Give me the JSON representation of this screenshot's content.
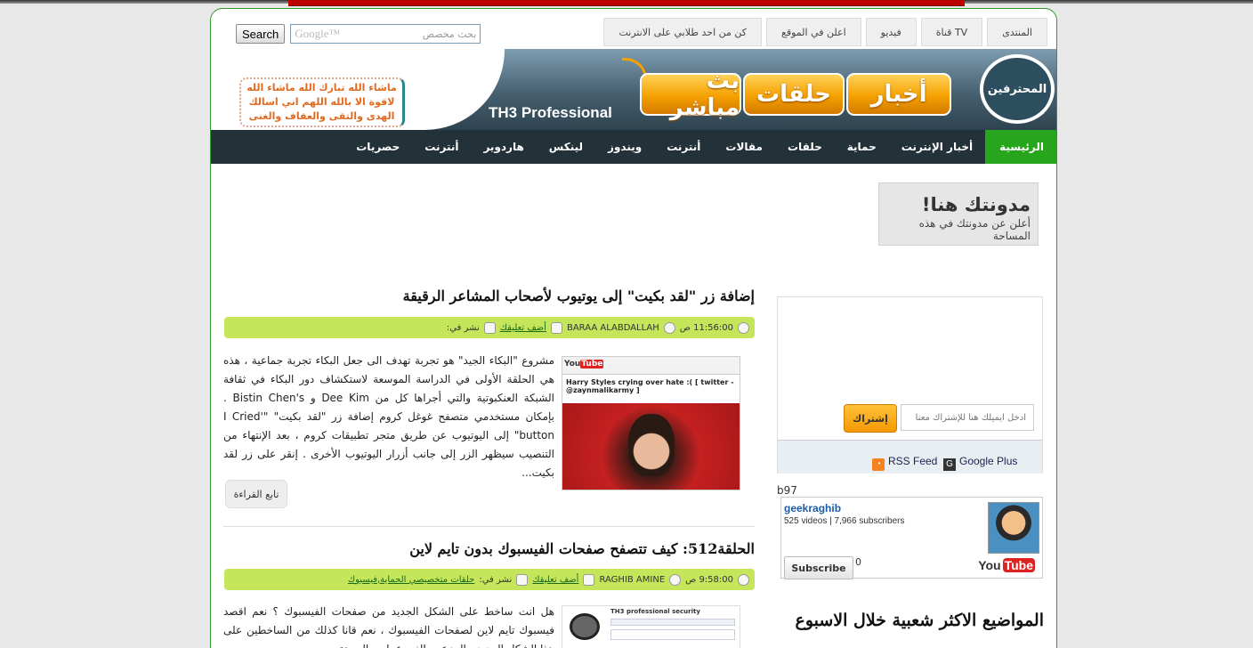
{
  "top_links": [
    "المنتدى",
    "قناة TV",
    "فيديو",
    "اعلن في الموقع",
    "كن من احد طلابي على الانترنت"
  ],
  "search": {
    "button": "Search",
    "google_label": "Google™",
    "placeholder": "بحث مخصص"
  },
  "banner": {
    "slogan": "ماشاء الله تبارك الله ماشاء الله لاقوة الا بالله اللهم اني اسالك الهدى والتقى والعفاف والغنى",
    "brand_en": "TH3 Professional",
    "buttons": [
      "أخبار",
      "حلقات",
      "بث مباشر"
    ],
    "logo_text": "المحترفين"
  },
  "nav": [
    "الرئيسية",
    "أخبار الإنترنت",
    "حماية",
    "حلقات",
    "مقالات",
    "أنترنت",
    "ويندوز",
    "لينكس",
    "هاردوير",
    "أنترنت",
    "حصريات"
  ],
  "sidebar": {
    "ad_title": "مدونتك هنا!",
    "ad_sub": "أعلن عن مدونتك في هذه المساحة",
    "subscribe_placeholder": "ادخل ايميلك هنا للإشتراك معنا",
    "subscribe_button": "إشتراك",
    "google_plus": "Google Plus",
    "rss": "RSS Feed",
    "b97": "b97",
    "yt_channel": "geekraghib",
    "yt_stats": "525 videos | 7,966 subscribers",
    "yt_subscribe": "Subscribe",
    "yt_count": "0",
    "yt_logo_you": "You",
    "yt_logo_tube": "Tube",
    "popular_title": "المواضيع الاكثر شعبية خلال الاسبوع"
  },
  "posts": [
    {
      "title": "إضافة زر \"لقد بكيت\" إلى يوتيوب لأصحاب المشاعر الرقيقة",
      "time": "11:56:00 ص",
      "author": "BARAA ALABDALLAH",
      "comment": "أضف تعليقك",
      "posted_in": "نشر في:",
      "category": "",
      "excerpt": "مشروع \"البكاء الجيد\" هو تجربة تهدف الى جعل البكاء تجربة جماعية ، هذه هي الحلقة الأولى في الدراسة الموسعة لاستكشاف دور البكاء في ثقافة الشبكة العنكبوتية والتي أجراها كل من Dee Kim و Bistin Chen's . بإمكان مستخدمي متصفح غوغل كروم إضافة زر \"لقد بكيت\" \"I Cried' button\" إلى اليوتيوب عن طريق متجر تطبيقات كروم ، بعد الإنتهاء من التنصيب سيظهر الزر إلى جانب أزرار اليوتيوب الأخرى . إنقر على زر لقد بكيت...",
      "read_more": "تابع القراءة",
      "thumb_title": "Harry Styles crying over hate :( [ twitter - @zaynmalikarmy ]"
    },
    {
      "title": "الحلقة512: كيف تتصفح صفحات الفيسبوك بدون تايم لاين",
      "time": "9:58:00 ص",
      "author": "RAGHIB AMINE",
      "comment": "أضف تعليقك",
      "posted_in": "نشر في:",
      "category": "حلقات متخصيصي الحماية,فيسبوك",
      "excerpt": "هل انت ساخط على الشكل الجديد من صفحات الفيسبوك ؟ نعم اقصد فيسبوك تايم لاين لصفحات الفيسبوك ، نعم قانا كذلك من الساخطين على هذا الشكل الجديد ، المزعج والغير عملي والمرهق",
      "thumb_title": "TH3 professional security"
    }
  ],
  "colors": {
    "nav_bg": "#233139",
    "nav_active": "#27a51d",
    "meta_bg": "#c5e65a",
    "orange": "#f5a000"
  }
}
